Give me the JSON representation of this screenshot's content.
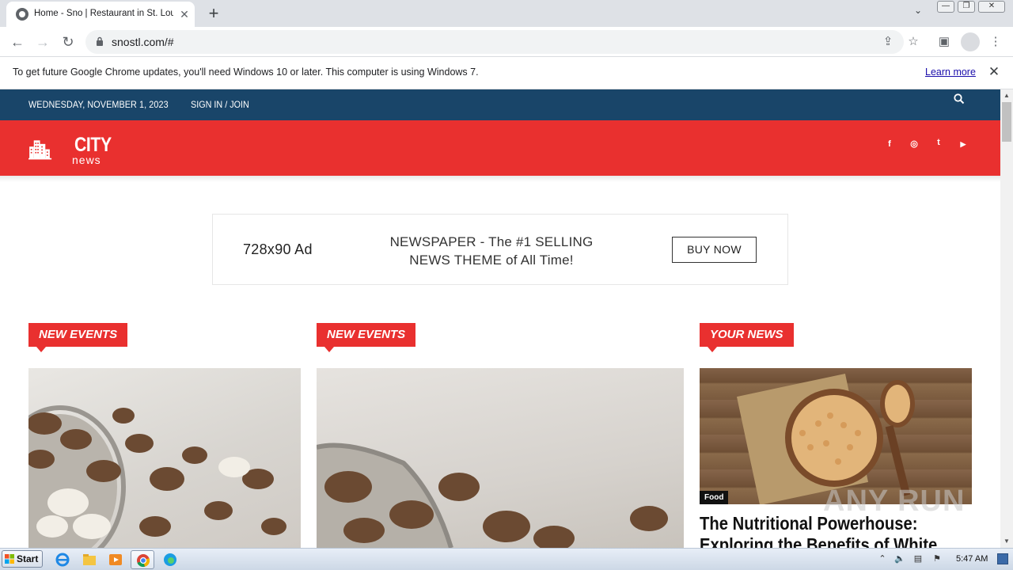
{
  "browser": {
    "tab_title": "Home - Sno | Restaurant in St. Louis",
    "tab_close": "✕",
    "new_tab": "+",
    "url": "snostl.com/#",
    "infobar_text": "To get future Google Chrome updates, you'll need Windows 10 or later. This computer is using Windows 7.",
    "infobar_link": "Learn more"
  },
  "site": {
    "date": "WEDNESDAY, NOVEMBER 1, 2023",
    "signin": "SIGN IN / JOIN",
    "logo_city": "CITY",
    "logo_news": "news",
    "social": [
      "f",
      "◎",
      "t",
      "▶"
    ],
    "colors": {
      "topbar": "#194569",
      "header": "#e9302f"
    }
  },
  "ad": {
    "size_label": "728x90 Ad",
    "copy": "NEWSPAPER - The #1 SELLING NEWS THEME of All Time!",
    "button": "BUY NOW"
  },
  "columns": [
    {
      "category": "NEW EVENTS"
    },
    {
      "category": "NEW EVENTS"
    },
    {
      "category": "YOUR NEWS",
      "badge": "Food",
      "headline": "The Nutritional Powerhouse: Exploring the Benefits of White"
    }
  ],
  "taskbar": {
    "start": "Start",
    "clock": "5:47 AM"
  },
  "watermark": "ANY RUN"
}
